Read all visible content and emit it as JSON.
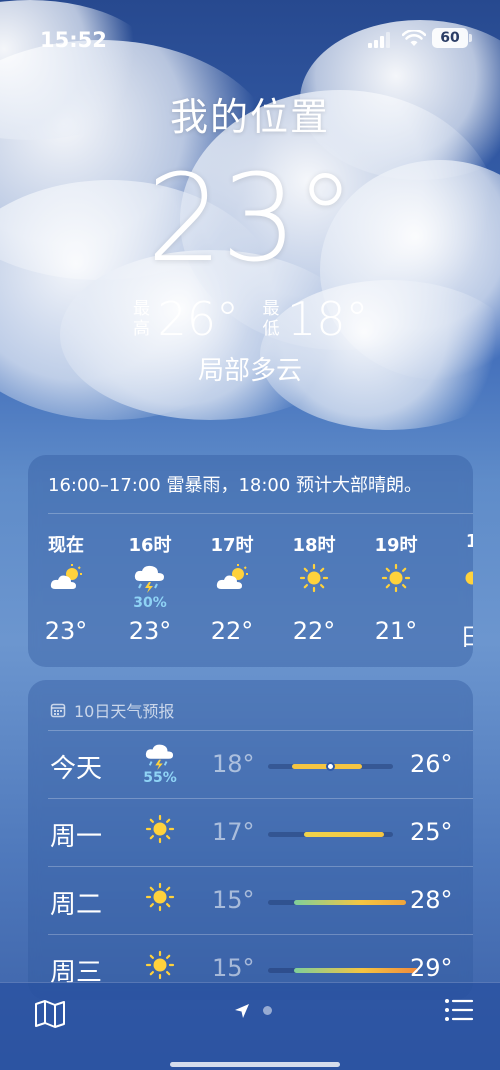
{
  "status_bar": {
    "time": "15:52",
    "battery": "60"
  },
  "current": {
    "location": "我的位置",
    "temperature": "23°",
    "high_label": "最高",
    "high": "26°",
    "low_label": "最低",
    "low": "18°",
    "condition": "局部多云"
  },
  "hourly": {
    "summary": "16:00–17:00 雷暴雨，18:00 预计大部晴朗。",
    "items": [
      {
        "label": "现在",
        "icon": "partly-cloudy-icon",
        "precip": "",
        "temp": "23°"
      },
      {
        "label": "16时",
        "icon": "thunderstorm-icon",
        "precip": "30%",
        "temp": "23°"
      },
      {
        "label": "17时",
        "icon": "partly-cloudy-icon",
        "precip": "",
        "temp": "22°"
      },
      {
        "label": "18时",
        "icon": "sun-icon",
        "precip": "",
        "temp": "22°"
      },
      {
        "label": "19时",
        "icon": "sun-icon",
        "precip": "",
        "temp": "21°"
      },
      {
        "label": "1",
        "icon": "sun-icon",
        "precip": "",
        "temp": "日"
      }
    ]
  },
  "daily": {
    "header": "10日天气预报",
    "days": [
      {
        "name": "今天",
        "icon": "thunderstorm-icon",
        "precip": "55%",
        "low": "18°",
        "high": "26°"
      },
      {
        "name": "周一",
        "icon": "sun-icon",
        "precip": "",
        "low": "17°",
        "high": "25°"
      },
      {
        "name": "周二",
        "icon": "sun-icon",
        "precip": "",
        "low": "15°",
        "high": "28°"
      },
      {
        "name": "周三",
        "icon": "sun-icon",
        "precip": "",
        "low": "15°",
        "high": "29°"
      }
    ]
  },
  "colors": {
    "precip": "#8fd3f5",
    "sun": "#ffd23c",
    "bar_warm": "#f5c542",
    "bar_hot": "#f08a3c"
  }
}
